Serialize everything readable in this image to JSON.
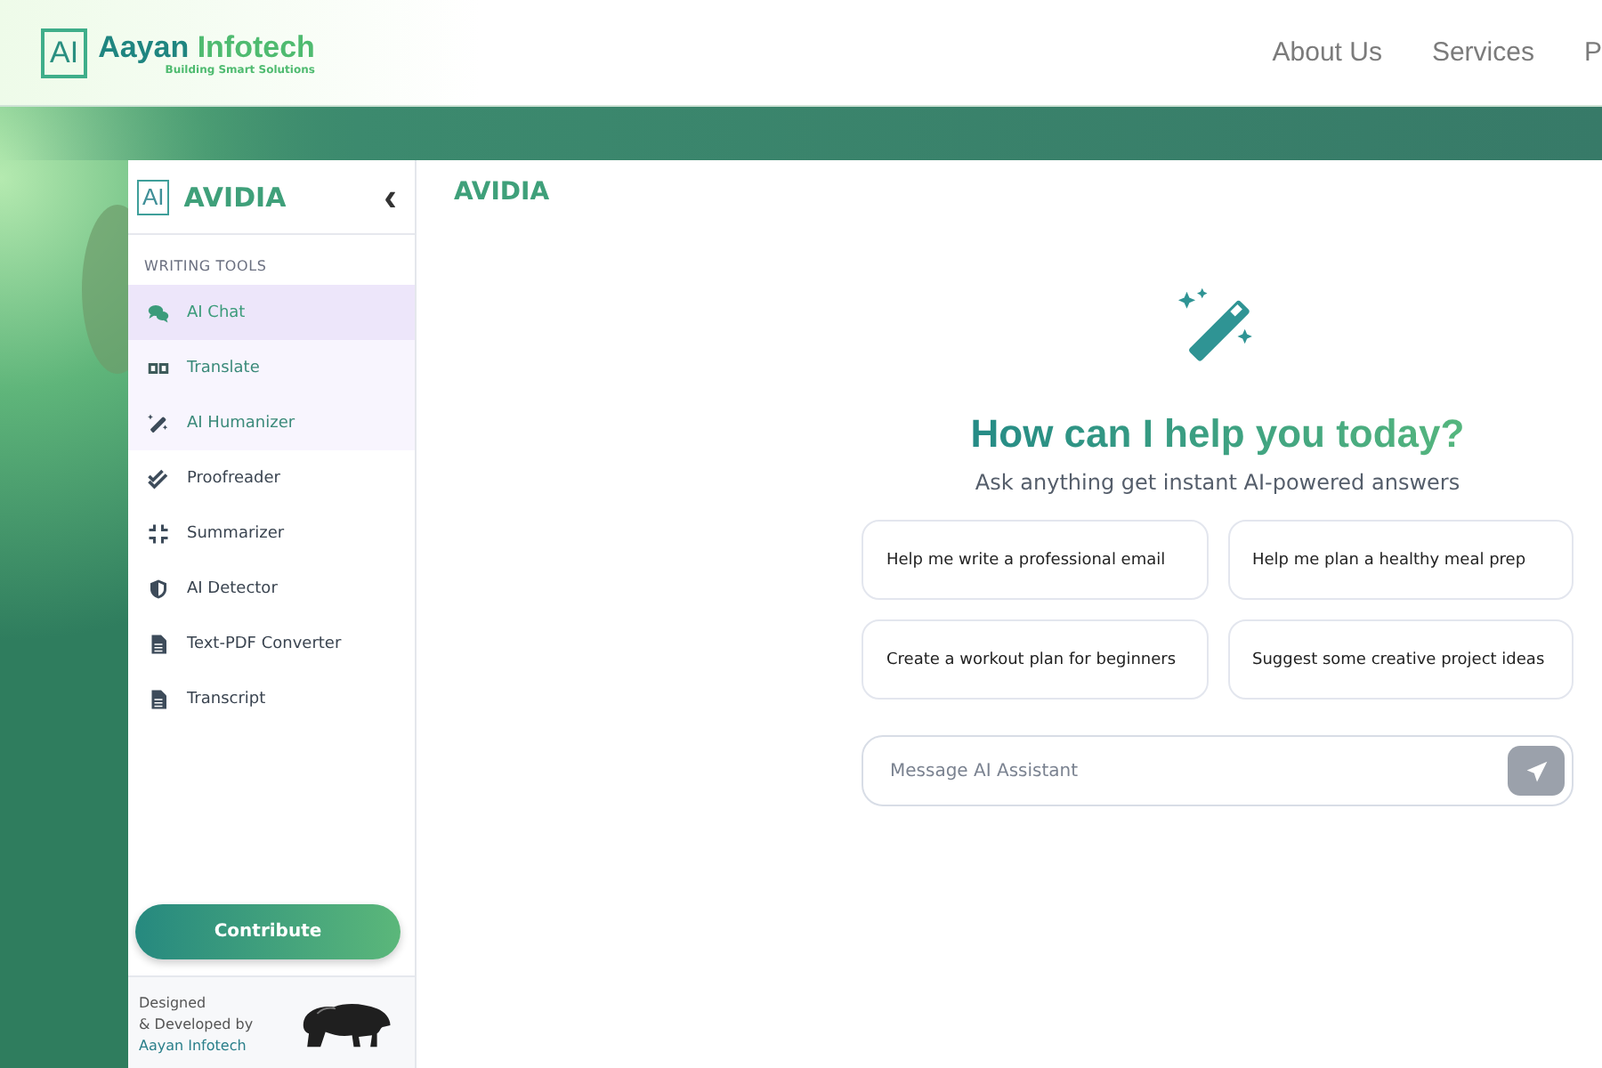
{
  "header": {
    "logo_mark": "AI",
    "brand_first": "Aayan",
    "brand_second": "Infotech",
    "tagline": "Building Smart Solutions",
    "nav": [
      {
        "label": "About Us"
      },
      {
        "label": "Services"
      },
      {
        "label": "P"
      }
    ]
  },
  "sidebar": {
    "logo_mark": "AI",
    "title": "AVIDIA",
    "collapse_icon": "‹",
    "section": "WRITING TOOLS",
    "items": [
      {
        "label": "AI Chat",
        "kind": "chat",
        "selected": true,
        "highlighted": true
      },
      {
        "label": "Translate",
        "kind": "translate",
        "selected": false,
        "highlighted": true
      },
      {
        "label": "AI Humanizer",
        "kind": "humanize",
        "selected": false,
        "highlighted": true
      },
      {
        "label": "Proofreader",
        "kind": "proofread",
        "selected": false,
        "highlighted": false
      },
      {
        "label": "Summarizer",
        "kind": "summarize",
        "selected": false,
        "highlighted": false
      },
      {
        "label": "AI Detector",
        "kind": "detect",
        "selected": false,
        "highlighted": false
      },
      {
        "label": "Text-PDF Converter",
        "kind": "document",
        "selected": false,
        "highlighted": false
      },
      {
        "label": "Transcript",
        "kind": "document",
        "selected": false,
        "highlighted": false
      }
    ],
    "contribute": "Contribute",
    "credit_lines": [
      "Designed",
      "& Developed by"
    ],
    "credit_link": "Aayan Infotech"
  },
  "main": {
    "title": "AVIDIA",
    "heading": "How can I help you today?",
    "subheading": "Ask anything get instant AI-powered answers",
    "suggestions": [
      {
        "label": "Help me write a professional email"
      },
      {
        "label": "Help me plan a healthy meal prep"
      },
      {
        "label": "Create a workout plan for beginners"
      },
      {
        "label": "Suggest some creative project ideas"
      }
    ],
    "input": {
      "placeholder": "Message AI Assistant"
    }
  }
}
